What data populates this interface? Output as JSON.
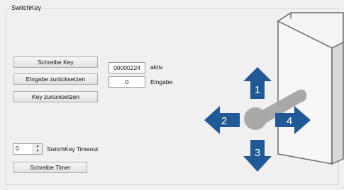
{
  "group": {
    "title": "SwitchKey"
  },
  "buttons": {
    "write_key": "Schreibe Key",
    "reset_input": "Eingabe zurücksetzen",
    "reset_key": "Key zurücksetzen",
    "write_timer": "Schreibe Timer"
  },
  "fields": {
    "active_value": "00000224",
    "active_label": "aktiv",
    "input_value": "0",
    "input_label": "Eingabe"
  },
  "timeout": {
    "value": "0",
    "label": "SwitchKey Timeout"
  },
  "arrows": {
    "up": "1",
    "left": "2",
    "down": "3",
    "right": "4"
  },
  "colors": {
    "arrow_fill": "#1f5a96",
    "lock_fill": "#a9a9a9"
  }
}
